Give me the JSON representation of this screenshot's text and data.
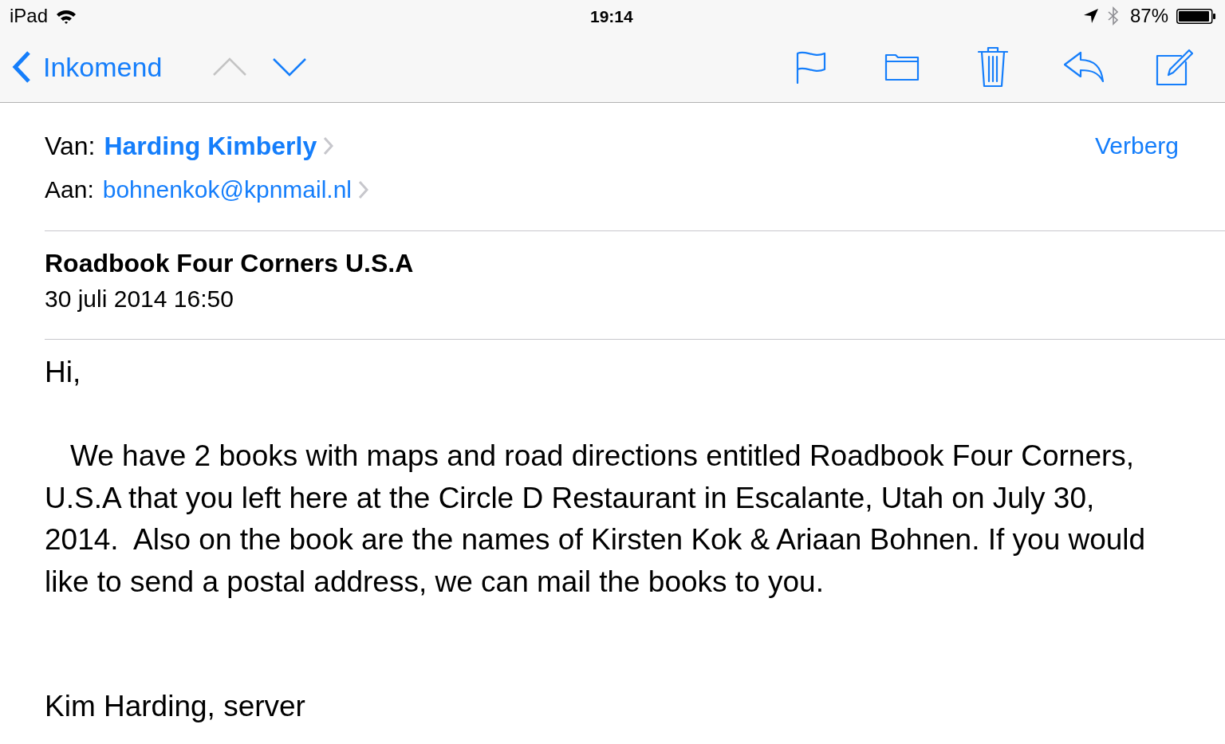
{
  "status_bar": {
    "device": "iPad",
    "time": "19:14",
    "battery": "87%"
  },
  "nav_bar": {
    "back": "Inkomend",
    "previous": {
      "disabled": true
    },
    "next": {
      "disabled": false
    }
  },
  "header": {
    "from_label": "Van:",
    "from": "Harding Kimberly",
    "to_label": "Aan:",
    "to": "bohnenkok@kpnmail.nl",
    "hide": "Verberg"
  },
  "message": {
    "subject": "Roadbook Four Corners U.S.A",
    "date": "30 juli 2014 16:50"
  },
  "body": [
    {
      "kind": "greeting",
      "text": "Hi,"
    },
    {
      "kind": "paragraph",
      "text": "We have 2 books with maps and road directions entitled Roadbook Four Corners, U.S.A that you left here at the Circle D Restaurant in Escalante, Utah on July 30, 2014.  Also on the book are the names of Kirsten Kok & Ariaan Bohnen. If you would like to send a postal address, we can mail the books to you."
    },
    {
      "kind": "signature",
      "text": "Kim Harding, server"
    }
  ]
}
